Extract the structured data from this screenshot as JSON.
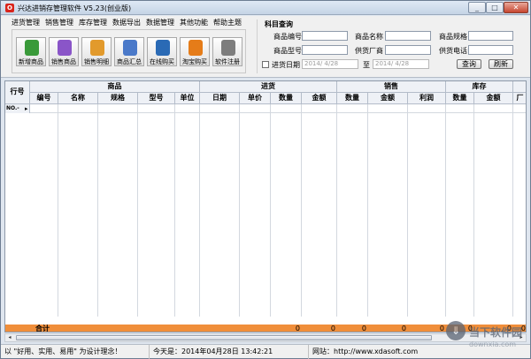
{
  "window": {
    "title": "兴达进销存管理软件 V5.23(创业版)",
    "app_icon_glyph": "O",
    "close_glyph": "✕",
    "max_glyph": "□",
    "min_glyph": "_"
  },
  "menu": [
    "进货管理",
    "销售管理",
    "库存管理",
    "数据导出",
    "数据管理",
    "其他功能",
    "帮助主题"
  ],
  "toolbar": [
    {
      "label": "新增商品",
      "icon": "document-add-icon",
      "color": "#3a9a3a"
    },
    {
      "label": "销售商品",
      "icon": "cube-icon",
      "color": "#8a55c8"
    },
    {
      "label": "销售明细",
      "icon": "users-icon",
      "color": "#e29a2c"
    },
    {
      "label": "商品汇总",
      "icon": "pie-chart-icon",
      "color": "#4a79c9"
    },
    {
      "label": "在线购买",
      "icon": "online-buy-icon",
      "color": "#2a6ab5"
    },
    {
      "label": "淘宝购买",
      "icon": "taobao-icon",
      "color": "#e57c19"
    },
    {
      "label": "软件注册",
      "icon": "register-icon",
      "color": "#7d7d7d"
    }
  ],
  "query": {
    "title": "科目查询",
    "labels": {
      "code": "商品编号",
      "name": "商品名称",
      "spec": "商品规格",
      "model": "商品型号",
      "supplier": "供货厂商",
      "phone": "供货电话",
      "date": "进货日期",
      "to": "至"
    },
    "date_from": "2014/ 4/28",
    "date_to": "2014/ 4/28",
    "query_btn": "查询",
    "refresh_btn": "刷新"
  },
  "grid": {
    "row_header_label": "行号",
    "groups": [
      "商品",
      "进货",
      "销售",
      "库存"
    ],
    "columns": [
      "编号",
      "名称",
      "规格",
      "型号",
      "单位",
      "日期",
      "单价",
      "数量",
      "金额",
      "数量",
      "金额",
      "利润",
      "数量",
      "金额",
      "厂"
    ],
    "first_row_label": "NO.-",
    "first_row_marker": "▸",
    "total_label": "合计",
    "total_values": [
      "0",
      "0",
      "0",
      "0",
      "0",
      "0",
      "0",
      "0"
    ]
  },
  "scrollbar": {
    "left_arrow": "◂",
    "right_arrow": "▸"
  },
  "status": {
    "slogan": "以 \"好用、实用、易用\" 为设计理念！",
    "today": "今天是：2014年04月28日  13:42:21",
    "website": "网站：http://www.xdasoft.com"
  },
  "watermark": {
    "mark": "⇓",
    "text": "当下软件园",
    "sub": "downxia.com"
  }
}
